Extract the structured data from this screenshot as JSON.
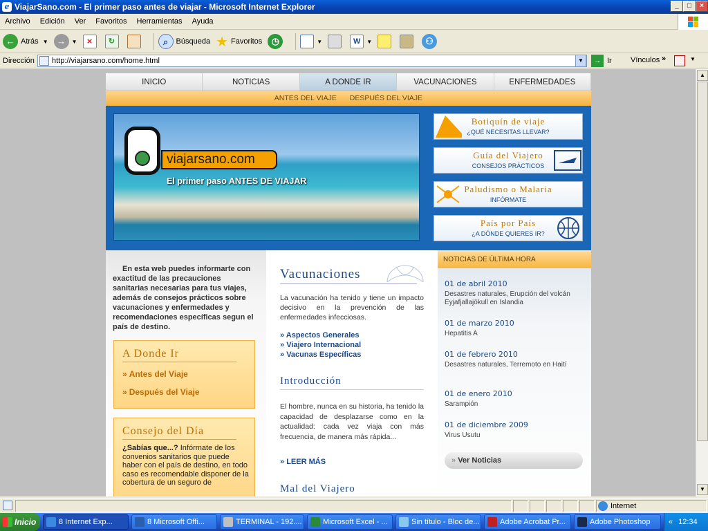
{
  "window": {
    "title": "ViajarSano.com - El primer paso antes de viajar - Microsoft Internet Explorer"
  },
  "menu": [
    "Archivo",
    "Edición",
    "Ver",
    "Favoritos",
    "Herramientas",
    "Ayuda"
  ],
  "toolbar": {
    "back": "Atrás",
    "search": "Búsqueda",
    "favorites": "Favoritos"
  },
  "address": {
    "label": "Dirección",
    "url": "http://viajarsano.com/home.html",
    "go": "Ir",
    "links": "Vínculos"
  },
  "site": {
    "nav": [
      "INICIO",
      "NOTICIAS",
      "A DONDE IR",
      "VACUNACIONES",
      "ENFERMEDADES"
    ],
    "subnav": [
      "ANTES DEL VIAJE",
      "DESPUÉS DEL VIAJE"
    ],
    "logo_text": "viajarsano.com",
    "tagline": "El primer paso ANTES DE VIAJAR",
    "side_buttons": [
      {
        "title": "Botiquín de viaje",
        "sub": "¿QUÉ NECESITAS LLEVAR?"
      },
      {
        "title": "Guía del Viajero",
        "sub": "CONSEJOS PRÁCTICOS"
      },
      {
        "title": "Paludismo o Malaria",
        "sub": "INFÓRMATE"
      },
      {
        "title": "País por País",
        "sub": "¿A DÓNDE QUIERES IR?"
      }
    ],
    "intro": "En esta web puedes informarte con exactitud de las precauciones sanitarias necesarias para tus viajes, además de consejos prácticos sobre vacunaciones y enfermedades y recomendaciones específicas segun el país de destino.",
    "adonde": {
      "title": "A Donde Ir",
      "links": [
        "Antes del Viaje",
        "Después del Viaje"
      ]
    },
    "consejo": {
      "title": "Consejo del Día",
      "lead": "¿Sabías que...?",
      "text": " Infórmate de los convenios sanitarios que puede haber con el país de destino, en todo caso es recomendable disponer de la cobertura de un seguro de"
    },
    "vacunaciones": {
      "title": "Vacunaciones",
      "text": "La vacunación ha tenido y tiene un impacto decisivo en la prevención de las enfermedades infecciosas.",
      "links": [
        "Aspectos Generales",
        "Viajero Internacional",
        "Vacunas Específicas"
      ]
    },
    "introduccion": {
      "title": "Introducción",
      "text": "El hombre, nunca en su historia, ha tenido la capacidad de desplazarse como en la actualidad: cada vez viaja con más frecuencia, de manera más rápida...",
      "more": "LEER MÁS"
    },
    "mal": {
      "title": "Mal del Viajero"
    },
    "news": {
      "header": "NOTICIAS DE ÚLTIMA HORA",
      "items": [
        {
          "date": "01 de abril 2010",
          "text": "Desastres naturales, Erupción del volcán Eyjafjallajökull en Islandia"
        },
        {
          "date": "01 de marzo 2010",
          "text": "Hepatitis A"
        },
        {
          "date": "01 de febrero 2010",
          "text": "Desastres naturales, Terremoto en Haití"
        },
        {
          "date": "01 de enero 2010",
          "text": "Sarampión"
        },
        {
          "date": "01 de diciembre 2009",
          "text": "Virus Usutu"
        }
      ],
      "more": "Ver Noticias"
    }
  },
  "status": {
    "zone": "Internet"
  },
  "taskbar": {
    "start": "Inicio",
    "tasks": [
      "8 Internet Exp...",
      "8 Microsoft Offi...",
      "TERMINAL - 192....",
      "Microsoft Excel - ...",
      "Sin título - Bloc de...",
      "Adobe Acrobat Pr...",
      "Adobe Photoshop"
    ],
    "clock": "12:34"
  },
  "colors": {
    "brand_blue": "#1a67b8",
    "accent_orange": "#f6b23e",
    "title_blue": "#1b4a8a"
  }
}
